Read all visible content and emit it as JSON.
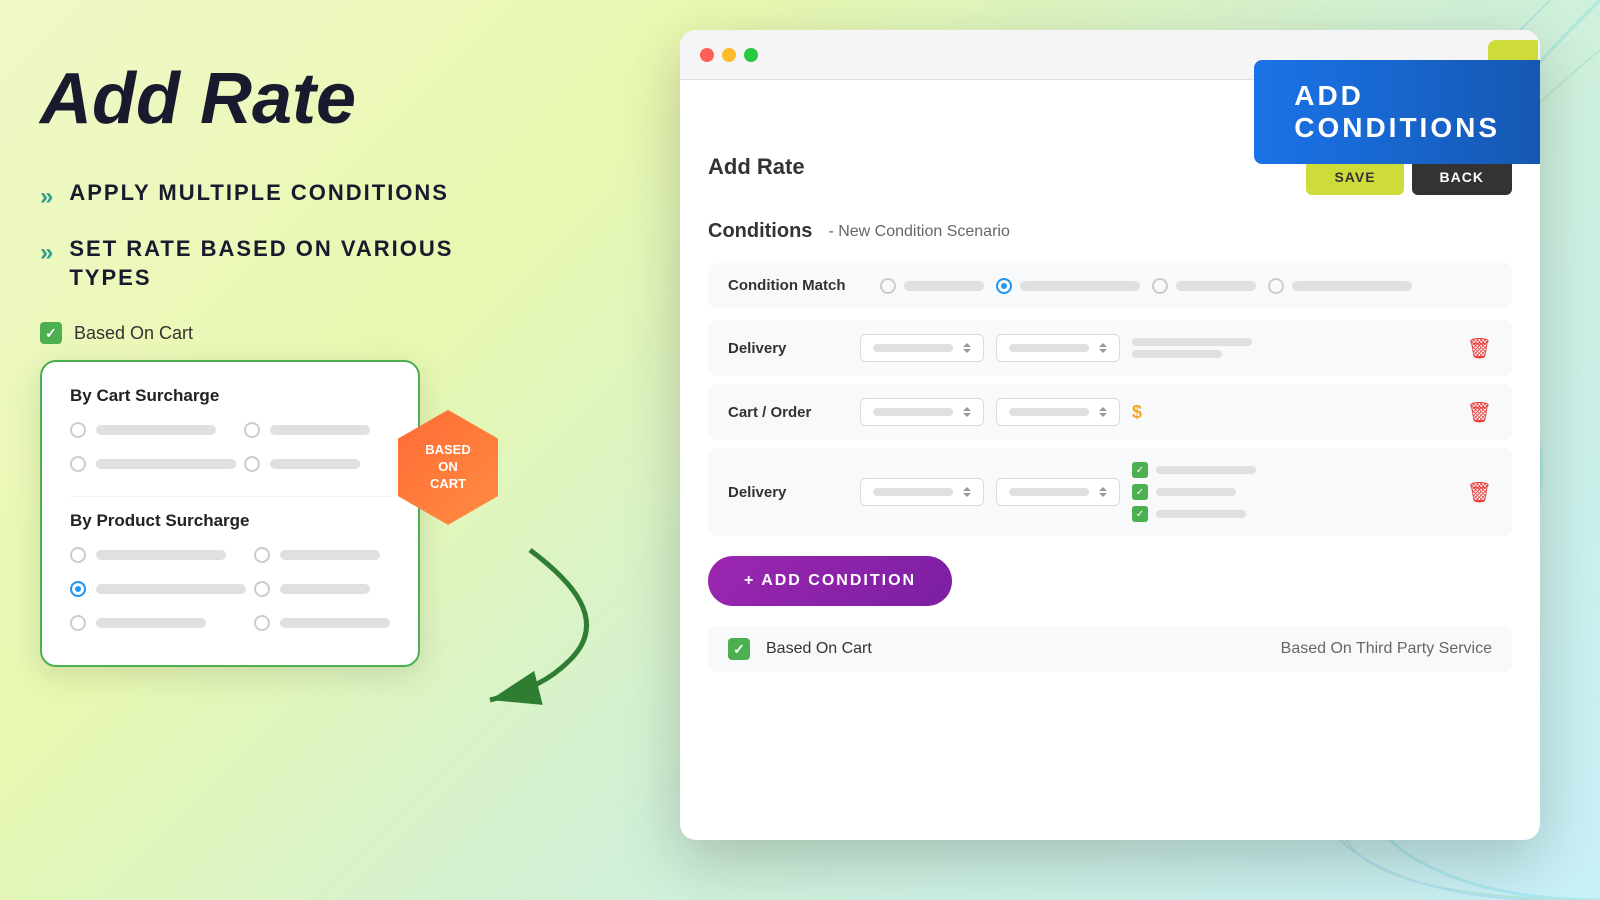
{
  "page": {
    "title": "Add Rate",
    "background_color": "#f0f8c8"
  },
  "left_panel": {
    "main_title": "Add Rate",
    "bullet1": {
      "icon": "»",
      "text": "APPLY MULTIPLE CONDITIONS"
    },
    "bullet2": {
      "icon": "»",
      "text": "SET RATE BASED ON VARIOUS TYPES"
    },
    "checkbox_label": "Based On Cart",
    "popup": {
      "section1_title": "By Cart Surcharge",
      "section2_title": "By Product Surcharge"
    },
    "hex_badge": {
      "line1": "BASED",
      "line2": "ON",
      "line3": "CART"
    }
  },
  "browser": {
    "title": "Add Rate",
    "conditions_title": "Conditions",
    "conditions_subtitle": "- New Condition Scenario",
    "condition_match_label": "Condition Match",
    "delivery_label": "Delivery",
    "cart_order_label": "Cart / Order",
    "add_condition_btn": "+ ADD CONDITION",
    "based_on_cart_label": "Based On Cart",
    "based_on_third_party_label": "Based On Third Party Service",
    "save_btn": "SAVE",
    "back_btn": "BACK",
    "add_conditions_banner": "ADD CONDITIONS"
  }
}
